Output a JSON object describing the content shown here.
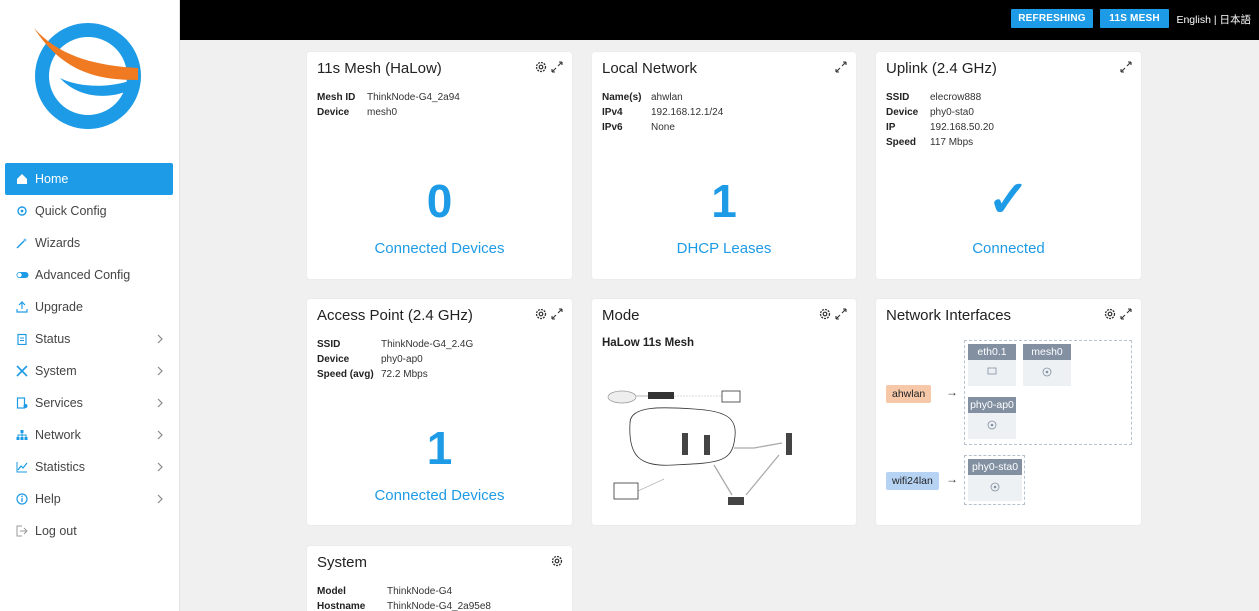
{
  "brand": {
    "colors": {
      "accent": "#1e9be6",
      "logo_blue": "#1e9be6",
      "logo_orange": "#f07a22"
    }
  },
  "sidebar": {
    "items": [
      {
        "label": "Home",
        "icon": "home-icon",
        "active": true
      },
      {
        "label": "Quick Config",
        "icon": "gear-icon"
      },
      {
        "label": "Wizards",
        "icon": "wand-icon"
      },
      {
        "label": "Advanced Config",
        "icon": "toggle-icon"
      },
      {
        "label": "Upgrade",
        "icon": "upload-icon"
      },
      {
        "label": "Status",
        "icon": "clipboard-icon",
        "has_submenu": true
      },
      {
        "label": "System",
        "icon": "tools-icon",
        "has_submenu": true
      },
      {
        "label": "Services",
        "icon": "services-icon",
        "has_submenu": true
      },
      {
        "label": "Network",
        "icon": "network-icon",
        "has_submenu": true
      },
      {
        "label": "Statistics",
        "icon": "chart-line-icon",
        "has_submenu": true
      },
      {
        "label": "Help",
        "icon": "info-icon",
        "has_submenu": true
      },
      {
        "label": "Log out",
        "icon": "logout-icon"
      }
    ]
  },
  "topbar": {
    "refreshing_label": "REFRESHING",
    "mesh_label": "11S MESH",
    "lang_en": "English",
    "lang_sep": "|",
    "lang_ja": "日本語"
  },
  "cards": {
    "mesh": {
      "title": "11s Mesh (HaLow)",
      "fields": [
        {
          "k": "Mesh ID",
          "v": "ThinkNode-G4_2a94"
        },
        {
          "k": "Device",
          "v": "mesh0"
        }
      ],
      "value": "0",
      "label": "Connected Devices"
    },
    "local": {
      "title": "Local Network",
      "fields": [
        {
          "k": "Name(s)",
          "v": "ahwlan"
        },
        {
          "k": "IPv4",
          "v": "192.168.12.1/24"
        },
        {
          "k": "IPv6",
          "v": "None"
        }
      ],
      "value": "1",
      "label": "DHCP Leases"
    },
    "uplink": {
      "title": "Uplink (2.4 GHz)",
      "fields": [
        {
          "k": "SSID",
          "v": "elecrow888"
        },
        {
          "k": "Device",
          "v": "phy0-sta0"
        },
        {
          "k": "IP",
          "v": "192.168.50.20"
        },
        {
          "k": "Speed",
          "v": "117 Mbps"
        }
      ],
      "value": "✓",
      "label": "Connected"
    },
    "ap": {
      "title": "Access Point (2.4 GHz)",
      "fields": [
        {
          "k": "SSID",
          "v": "ThinkNode-G4_2.4G"
        },
        {
          "k": "Device",
          "v": "phy0-ap0"
        },
        {
          "k": "Speed (avg)",
          "v": "72.2 Mbps"
        }
      ],
      "value": "1",
      "label": "Connected Devices"
    },
    "mode": {
      "title": "Mode",
      "subtitle": "HaLow 11s Mesh"
    },
    "ifaces": {
      "title": "Network Interfaces",
      "groups": [
        {
          "network": "ahwlan",
          "color": "#f6c8a8",
          "devices": [
            "eth0.1",
            "mesh0",
            "phy0-ap0"
          ]
        },
        {
          "network": "wifi24lan",
          "color": "#b6d3f4",
          "devices": [
            "phy0-sta0"
          ]
        }
      ]
    },
    "system": {
      "title": "System",
      "fields": [
        {
          "k": "Model",
          "v": "ThinkNode-G4"
        },
        {
          "k": "Hostname",
          "v": "ThinkNode-G4_2a95e8"
        }
      ]
    }
  }
}
